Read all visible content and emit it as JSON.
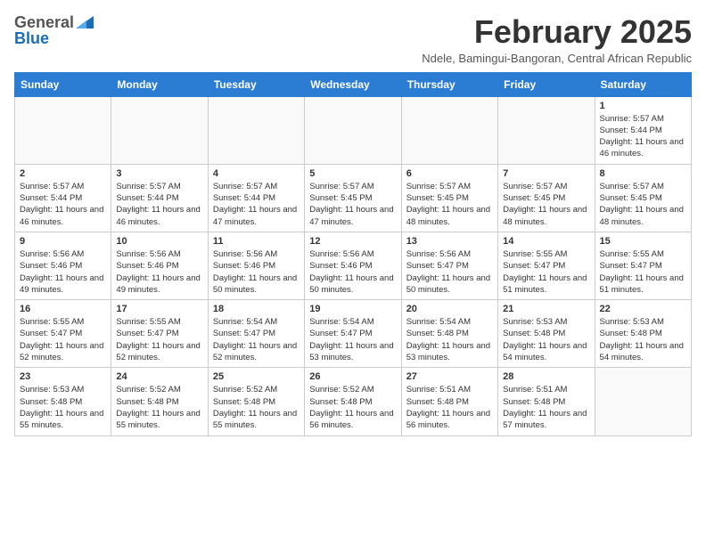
{
  "logo": {
    "general": "General",
    "blue": "Blue"
  },
  "header": {
    "month": "February 2025",
    "subtitle": "Ndele, Bamingui-Bangoran, Central African Republic"
  },
  "weekdays": [
    "Sunday",
    "Monday",
    "Tuesday",
    "Wednesday",
    "Thursday",
    "Friday",
    "Saturday"
  ],
  "weeks": [
    [
      {
        "day": "",
        "info": ""
      },
      {
        "day": "",
        "info": ""
      },
      {
        "day": "",
        "info": ""
      },
      {
        "day": "",
        "info": ""
      },
      {
        "day": "",
        "info": ""
      },
      {
        "day": "",
        "info": ""
      },
      {
        "day": "1",
        "info": "Sunrise: 5:57 AM\nSunset: 5:44 PM\nDaylight: 11 hours and 46 minutes."
      }
    ],
    [
      {
        "day": "2",
        "info": "Sunrise: 5:57 AM\nSunset: 5:44 PM\nDaylight: 11 hours and 46 minutes."
      },
      {
        "day": "3",
        "info": "Sunrise: 5:57 AM\nSunset: 5:44 PM\nDaylight: 11 hours and 46 minutes."
      },
      {
        "day": "4",
        "info": "Sunrise: 5:57 AM\nSunset: 5:44 PM\nDaylight: 11 hours and 47 minutes."
      },
      {
        "day": "5",
        "info": "Sunrise: 5:57 AM\nSunset: 5:45 PM\nDaylight: 11 hours and 47 minutes."
      },
      {
        "day": "6",
        "info": "Sunrise: 5:57 AM\nSunset: 5:45 PM\nDaylight: 11 hours and 48 minutes."
      },
      {
        "day": "7",
        "info": "Sunrise: 5:57 AM\nSunset: 5:45 PM\nDaylight: 11 hours and 48 minutes."
      },
      {
        "day": "8",
        "info": "Sunrise: 5:57 AM\nSunset: 5:45 PM\nDaylight: 11 hours and 48 minutes."
      }
    ],
    [
      {
        "day": "9",
        "info": "Sunrise: 5:56 AM\nSunset: 5:46 PM\nDaylight: 11 hours and 49 minutes."
      },
      {
        "day": "10",
        "info": "Sunrise: 5:56 AM\nSunset: 5:46 PM\nDaylight: 11 hours and 49 minutes."
      },
      {
        "day": "11",
        "info": "Sunrise: 5:56 AM\nSunset: 5:46 PM\nDaylight: 11 hours and 50 minutes."
      },
      {
        "day": "12",
        "info": "Sunrise: 5:56 AM\nSunset: 5:46 PM\nDaylight: 11 hours and 50 minutes."
      },
      {
        "day": "13",
        "info": "Sunrise: 5:56 AM\nSunset: 5:47 PM\nDaylight: 11 hours and 50 minutes."
      },
      {
        "day": "14",
        "info": "Sunrise: 5:55 AM\nSunset: 5:47 PM\nDaylight: 11 hours and 51 minutes."
      },
      {
        "day": "15",
        "info": "Sunrise: 5:55 AM\nSunset: 5:47 PM\nDaylight: 11 hours and 51 minutes."
      }
    ],
    [
      {
        "day": "16",
        "info": "Sunrise: 5:55 AM\nSunset: 5:47 PM\nDaylight: 11 hours and 52 minutes."
      },
      {
        "day": "17",
        "info": "Sunrise: 5:55 AM\nSunset: 5:47 PM\nDaylight: 11 hours and 52 minutes."
      },
      {
        "day": "18",
        "info": "Sunrise: 5:54 AM\nSunset: 5:47 PM\nDaylight: 11 hours and 52 minutes."
      },
      {
        "day": "19",
        "info": "Sunrise: 5:54 AM\nSunset: 5:47 PM\nDaylight: 11 hours and 53 minutes."
      },
      {
        "day": "20",
        "info": "Sunrise: 5:54 AM\nSunset: 5:48 PM\nDaylight: 11 hours and 53 minutes."
      },
      {
        "day": "21",
        "info": "Sunrise: 5:53 AM\nSunset: 5:48 PM\nDaylight: 11 hours and 54 minutes."
      },
      {
        "day": "22",
        "info": "Sunrise: 5:53 AM\nSunset: 5:48 PM\nDaylight: 11 hours and 54 minutes."
      }
    ],
    [
      {
        "day": "23",
        "info": "Sunrise: 5:53 AM\nSunset: 5:48 PM\nDaylight: 11 hours and 55 minutes."
      },
      {
        "day": "24",
        "info": "Sunrise: 5:52 AM\nSunset: 5:48 PM\nDaylight: 11 hours and 55 minutes."
      },
      {
        "day": "25",
        "info": "Sunrise: 5:52 AM\nSunset: 5:48 PM\nDaylight: 11 hours and 55 minutes."
      },
      {
        "day": "26",
        "info": "Sunrise: 5:52 AM\nSunset: 5:48 PM\nDaylight: 11 hours and 56 minutes."
      },
      {
        "day": "27",
        "info": "Sunrise: 5:51 AM\nSunset: 5:48 PM\nDaylight: 11 hours and 56 minutes."
      },
      {
        "day": "28",
        "info": "Sunrise: 5:51 AM\nSunset: 5:48 PM\nDaylight: 11 hours and 57 minutes."
      },
      {
        "day": "",
        "info": ""
      }
    ]
  ]
}
